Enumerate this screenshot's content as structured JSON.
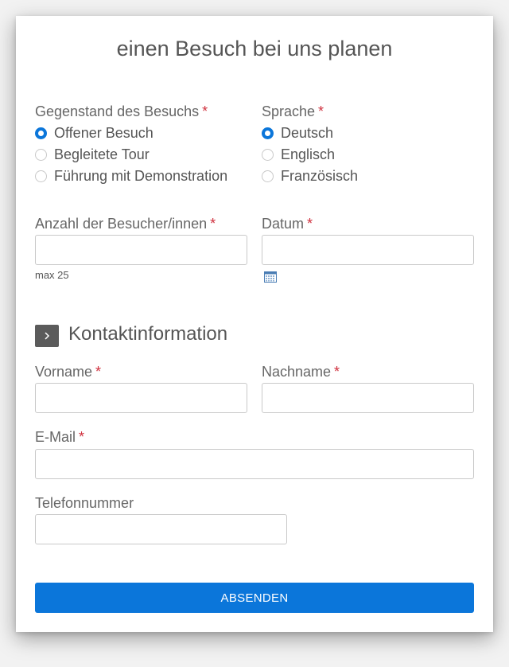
{
  "form": {
    "title": "einen Besuch bei uns planen",
    "required_mark": "*",
    "visit_subject": {
      "label": "Gegenstand des Besuchs",
      "options": [
        "Offener Besuch",
        "Begleitete Tour",
        "Führung mit Demonstration"
      ],
      "selected": "Offener Besuch"
    },
    "language": {
      "label": "Sprache",
      "options": [
        "Deutsch",
        "Englisch",
        "Französisch"
      ],
      "selected": "Deutsch"
    },
    "visitors": {
      "label": "Anzahl der Besucher/innen",
      "value": "",
      "hint": "max 25"
    },
    "date": {
      "label": "Datum",
      "value": "",
      "icon": "calendar-icon"
    },
    "contact_section": {
      "title": "Kontaktinformation",
      "toggle_icon": "chevron-right-icon"
    },
    "first_name": {
      "label": "Vorname",
      "value": ""
    },
    "last_name": {
      "label": "Nachname",
      "value": ""
    },
    "email": {
      "label": "E-Mail",
      "value": ""
    },
    "phone": {
      "label": "Telefonnummer",
      "value": ""
    },
    "submit_label": "ABSENDEN"
  },
  "colors": {
    "accent": "#0b76da",
    "required": "#d0323f",
    "section_toggle_bg": "#5b5b5b"
  }
}
